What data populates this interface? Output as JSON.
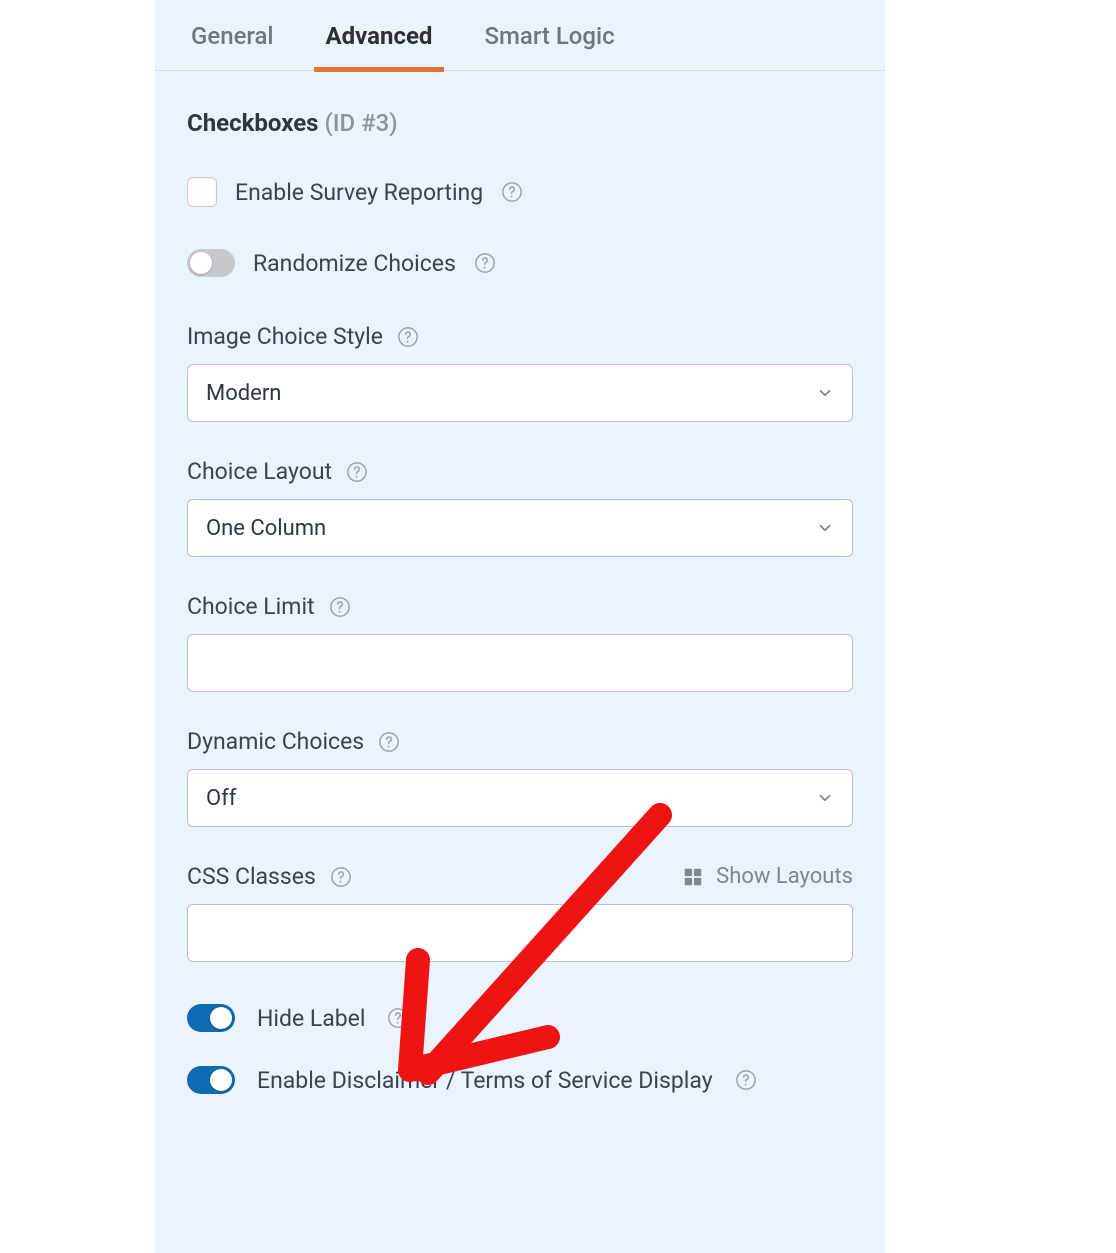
{
  "tabs": {
    "general": "General",
    "advanced": "Advanced",
    "smart_logic": "Smart Logic",
    "active": "advanced"
  },
  "header": {
    "title": "Checkboxes",
    "id_label": "(ID #3)"
  },
  "options": {
    "enable_survey_reporting": "Enable Survey Reporting",
    "randomize_choices": "Randomize Choices"
  },
  "groups": {
    "image_choice_style": {
      "label": "Image Choice Style",
      "value": "Modern"
    },
    "choice_layout": {
      "label": "Choice Layout",
      "value": "One Column"
    },
    "choice_limit": {
      "label": "Choice Limit",
      "value": ""
    },
    "dynamic_choices": {
      "label": "Dynamic Choices",
      "value": "Off"
    },
    "css_classes": {
      "label": "CSS Classes",
      "value": "",
      "show_layouts": "Show Layouts"
    }
  },
  "bottom": {
    "hide_label": "Hide Label",
    "enable_disclaimer": "Enable Disclaimer / Terms of Service Display"
  },
  "colors": {
    "accent": "#e27730",
    "toggle_on": "#0f6ab4",
    "annotation": "#ef1313"
  }
}
